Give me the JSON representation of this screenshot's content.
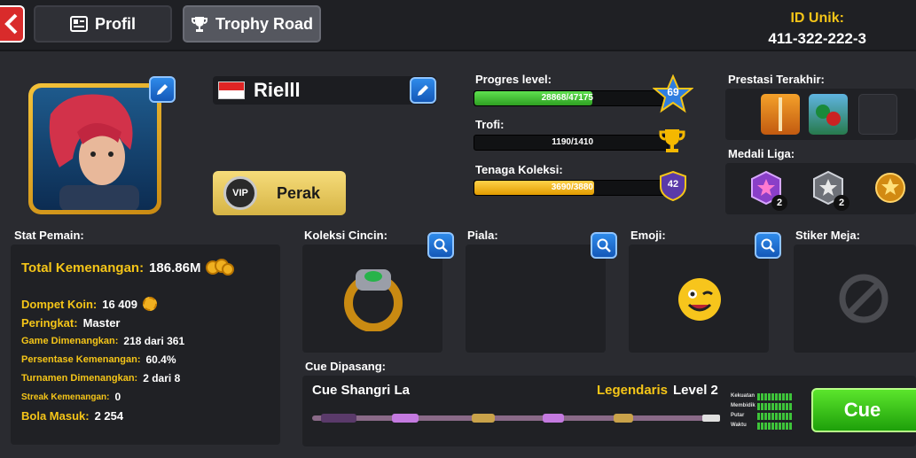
{
  "header": {
    "profile_tab": "Profil",
    "trophy_tab": "Trophy Road",
    "uid_label": "ID Unik:",
    "uid_value": "411-322-222-3"
  },
  "player": {
    "name": "Rielll",
    "vip_label": "Perak",
    "vip_badge": "VIP"
  },
  "progress": {
    "level_label": "Progres level:",
    "level_text": "28868/47175",
    "level_fraction": 0.612,
    "level_badge": "69",
    "trophy_label": "Trofi:",
    "trophy_text": "1190/1410",
    "trophy_fraction": 0.0,
    "collection_label": "Tenaga Koleksi:",
    "collection_text": "3690/3880",
    "collection_fraction": 0.62,
    "collection_badge": "42"
  },
  "side": {
    "achievements_label": "Prestasi Terakhir:",
    "medals_label": "Medali Liga:",
    "medals": [
      {
        "icon": "purple-medal-icon",
        "count": "2"
      },
      {
        "icon": "silver-medal-icon",
        "count": "2"
      },
      {
        "icon": "gold-medal-icon",
        "count": ""
      }
    ]
  },
  "stats": {
    "title": "Stat Pemain:",
    "total_wins_label": "Total Kemenangan:",
    "total_wins_value": "186.86M",
    "wallet_label": "Dompet Koin:",
    "wallet_value": "16 409",
    "rank_label": "Peringkat:",
    "rank_value": "Master",
    "games_won_label": "Game Dimenangkan:",
    "games_won_value": "218 dari 361",
    "win_pct_label": "Persentase Kemenangan:",
    "win_pct_value": "60.4%",
    "tourn_label": "Turnamen Dimenangkan:",
    "tourn_value": "2 dari 8",
    "streak_label": "Streak Kemenangan:",
    "streak_value": "0",
    "pot_label": "Bola Masuk:",
    "pot_value": "2 254"
  },
  "collections": {
    "rings_label": "Koleksi Cincin:",
    "trophies_label": "Piala:",
    "emoji_label": "Emoji:",
    "stickers_label": "Stiker Meja:"
  },
  "cue": {
    "title": "Cue Dipasang:",
    "name": "Cue Shangri La",
    "rarity": "Legendaris",
    "level": "Level 2",
    "stat_power": "Kekuatan",
    "stat_aim": "Membidik",
    "stat_spin": "Putar",
    "stat_time": "Waktu",
    "button": "Cue"
  },
  "colors": {
    "accent_yellow": "#f5c518",
    "level_bar": "#3ec43a",
    "collection_bar": "#f5b800",
    "button_blue": "#2f8bea",
    "button_green": "#2ac41a"
  }
}
